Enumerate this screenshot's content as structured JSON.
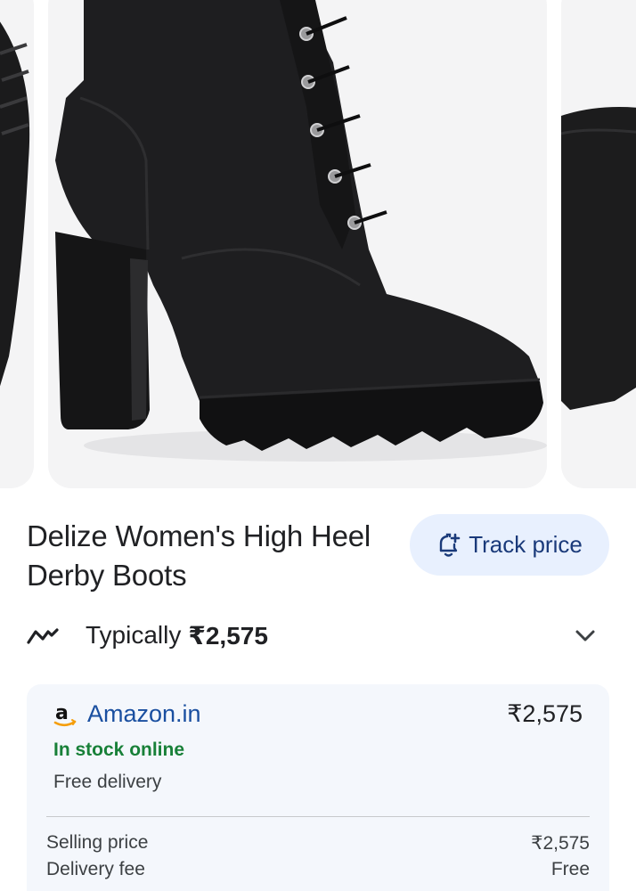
{
  "product": {
    "title": "Delize Women's High Heel Derby Boots"
  },
  "track_price": {
    "label": "Track price",
    "icon": "bell-plus-icon"
  },
  "typical": {
    "icon": "trend-line-icon",
    "label": "Typically",
    "price": "₹2,575",
    "expand_icon": "chevron-down-icon"
  },
  "seller": {
    "logo": "amazon-logo",
    "name": "Amazon.in",
    "price": "₹2,575",
    "stock": "In stock online",
    "delivery": "Free delivery",
    "rows": [
      {
        "label": "Selling price",
        "value": "₹2,575"
      },
      {
        "label": "Delivery fee",
        "value": "Free"
      }
    ]
  },
  "colors": {
    "accent_bg": "#e8f0fe",
    "link_blue": "#1a4fa0",
    "stock_green": "#188038",
    "card_bg": "#f4f7fc"
  }
}
